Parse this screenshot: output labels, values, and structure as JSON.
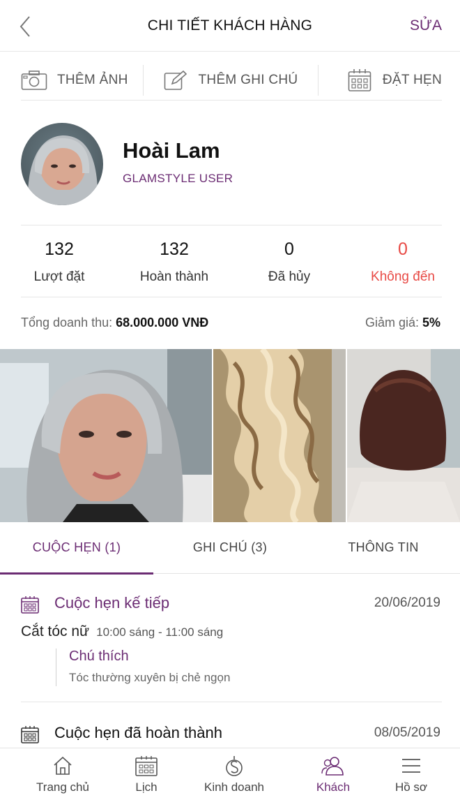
{
  "header": {
    "title": "CHI TIẾT KHÁCH HÀNG",
    "edit_label": "SỬA"
  },
  "actions": {
    "add_photo": "THÊM ẢNH",
    "add_note": "THÊM GHI CHÚ",
    "book": "ĐẶT HẸN"
  },
  "customer": {
    "name": "Hoài Lam",
    "type": "GLAMSTYLE USER"
  },
  "stats": [
    {
      "value": "132",
      "label": "Lượt đặt"
    },
    {
      "value": "132",
      "label": "Hoàn thành"
    },
    {
      "value": "0",
      "label": "Đã hủy"
    },
    {
      "value": "0",
      "label": "Không đến"
    }
  ],
  "revenue": {
    "label": "Tổng doanh thu:",
    "value": "68.000.000 VNĐ"
  },
  "discount": {
    "label": "Giảm giá:",
    "value": "5%"
  },
  "tabs": [
    {
      "label": "CUỘC HẸN (1)"
    },
    {
      "label": "GHI CHÚ (3)"
    },
    {
      "label": "THÔNG TIN"
    }
  ],
  "appointments": {
    "next": {
      "title": "Cuộc hẹn kế tiếp",
      "date": "20/06/2019",
      "service": "Cắt tóc nữ",
      "time": "10:00 sáng - 11:00 sáng",
      "note_title": "Chú thích",
      "note_text": "Tóc thường xuyên bị chẻ ngọn"
    },
    "completed": {
      "title": "Cuộc hẹn đã hoàn thành",
      "date": "08/05/2019"
    }
  },
  "bottom_nav": [
    {
      "label": "Trang chủ",
      "icon": "home-icon"
    },
    {
      "label": "Lịch",
      "icon": "calendar-icon"
    },
    {
      "label": "Kinh doanh",
      "icon": "business-icon"
    },
    {
      "label": "Khách",
      "icon": "customers-icon"
    },
    {
      "label": "Hồ sơ",
      "icon": "menu-icon"
    }
  ],
  "colors": {
    "accent": "#6b2c73",
    "danger": "#e84a45",
    "text": "#1a1a1a",
    "divider": "#e6e6e6"
  }
}
